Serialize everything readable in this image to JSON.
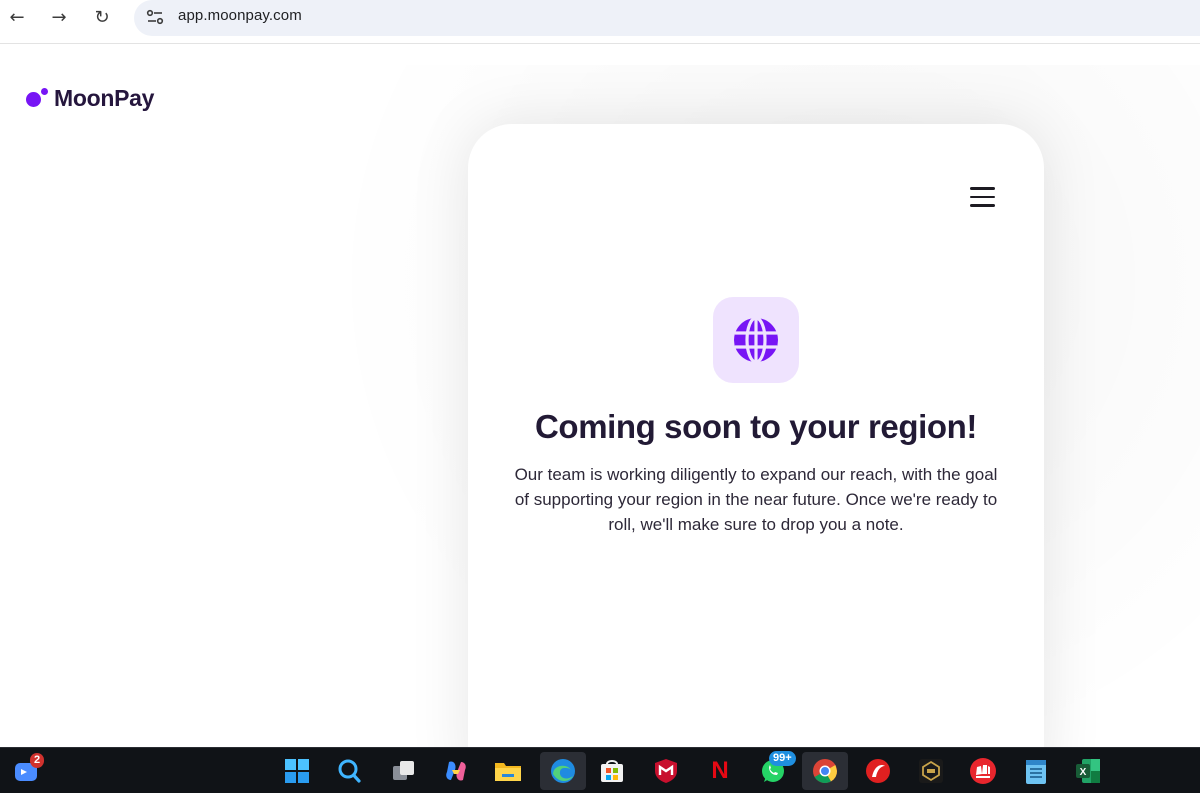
{
  "browser": {
    "url": "app.moonpay.com",
    "back_glyph": "←",
    "forward_glyph": "→",
    "reload_glyph": "↻"
  },
  "logo": {
    "text": "MoonPay",
    "color": "#7715f5"
  },
  "widget": {
    "icon": "globe-icon",
    "headline": "Coming soon to your region!",
    "body": "Our team is working diligently to expand our reach, with the goal of supporting your region in the near future. Once we're ready to roll, we'll make sure to drop you a note.",
    "accent": "#7715f5",
    "icon_bg": "#efe3fe"
  },
  "taskbar": {
    "items": [
      {
        "name": "zoom-icon",
        "badge": "2"
      },
      {
        "name": "windows-start-icon"
      },
      {
        "name": "search-icon"
      },
      {
        "name": "task-view-icon"
      },
      {
        "name": "copilot-icon"
      },
      {
        "name": "file-explorer-icon"
      },
      {
        "name": "edge-icon"
      },
      {
        "name": "microsoft-store-icon"
      },
      {
        "name": "mcafee-icon"
      },
      {
        "name": "netflix-icon",
        "text": "N"
      },
      {
        "name": "whatsapp-icon",
        "badge": "99+"
      },
      {
        "name": "chrome-icon"
      },
      {
        "name": "reader-icon"
      },
      {
        "name": "game-icon"
      },
      {
        "name": "riot-icon"
      },
      {
        "name": "notepad-icon"
      },
      {
        "name": "excel-icon",
        "text": "X"
      }
    ]
  }
}
